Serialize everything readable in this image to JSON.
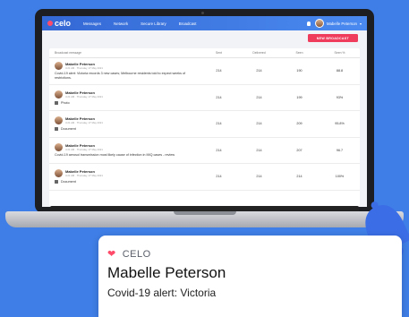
{
  "app": {
    "brand": "celo"
  },
  "nav": {
    "items": [
      "Messages",
      "Network",
      "Secure Library",
      "Broadcast"
    ],
    "user": "Mabelle Peterson"
  },
  "toolbar": {
    "new_broadcast": "NEW BROADCAST"
  },
  "table": {
    "headers": [
      "Broadcast message",
      "Sent",
      "Delivered",
      "Seen",
      "Seen %"
    ],
    "rows": [
      {
        "sender": "Mabelle Peterson",
        "time": "4:21 AM · Thursday, 27 May 2021",
        "message": "Covid-19 alert: Victoria records 3 new cases; Melbourne residents told to expect weeks of restrictions.",
        "attachment": "",
        "sent": "214",
        "delivered": "214",
        "seen": "190",
        "seen_pct": "88.8"
      },
      {
        "sender": "Mabelle Peterson",
        "time": "4:21 AM · Thursday, 27 May 2021",
        "message": "",
        "attachment": "Photo",
        "sent": "214",
        "delivered": "214",
        "seen": "199",
        "seen_pct": "93%"
      },
      {
        "sender": "Mabelle Peterson",
        "time": "4:21 AM · Thursday, 27 May 2021",
        "message": "",
        "attachment": "Document",
        "sent": "214",
        "delivered": "214",
        "seen": "209",
        "seen_pct": "95.8%"
      },
      {
        "sender": "Mabelle Peterson",
        "time": "4:21 AM · Thursday, 27 May 2021",
        "message": "Covid-19 aerosol transmission most likely cause of infection in MIQ cases - review",
        "attachment": "",
        "sent": "214",
        "delivered": "214",
        "seen": "207",
        "seen_pct": "96.7"
      },
      {
        "sender": "Mabelle Peterson",
        "time": "4:21 AM · Thursday, 27 May 2021",
        "message": "",
        "attachment": "Document",
        "sent": "214",
        "delivered": "214",
        "seen": "214",
        "seen_pct": "100%"
      }
    ]
  },
  "notification": {
    "brand": "CELO",
    "title": "Mabelle Peterson",
    "body": "Covid-19 alert: Victoria"
  },
  "colors": {
    "primary": "#3f7ee6",
    "accent": "#ef3b5c"
  }
}
